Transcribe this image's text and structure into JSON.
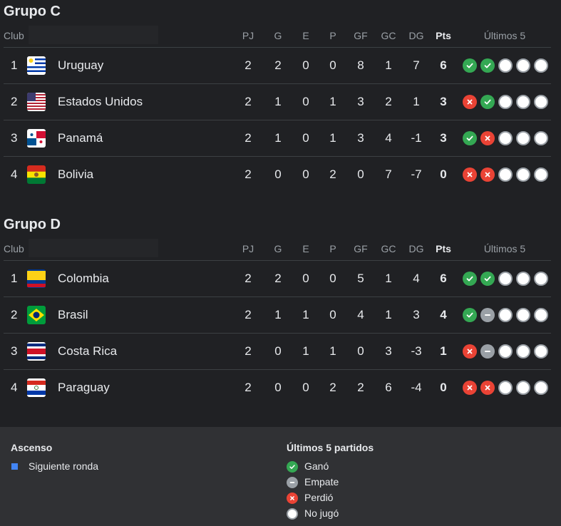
{
  "columns": {
    "club": "Club",
    "pj": "PJ",
    "g": "G",
    "e": "E",
    "p": "P",
    "gf": "GF",
    "gc": "GC",
    "dg": "DG",
    "pts": "Pts",
    "last5": "Últimos 5"
  },
  "groups": [
    {
      "title": "Grupo C",
      "teams": [
        {
          "pos": "1",
          "name": "Uruguay",
          "flag": "uruguay-flag",
          "pj": "2",
          "g": "2",
          "e": "0",
          "p": "0",
          "gf": "8",
          "gc": "1",
          "dg": "7",
          "pts": "6",
          "form": [
            "W",
            "W",
            "N",
            "N",
            "N"
          ]
        },
        {
          "pos": "2",
          "name": "Estados Unidos",
          "flag": "usa-flag",
          "pj": "2",
          "g": "1",
          "e": "0",
          "p": "1",
          "gf": "3",
          "gc": "2",
          "dg": "1",
          "pts": "3",
          "form": [
            "L",
            "W",
            "N",
            "N",
            "N"
          ]
        },
        {
          "pos": "3",
          "name": "Panamá",
          "flag": "panama-flag",
          "pj": "2",
          "g": "1",
          "e": "0",
          "p": "1",
          "gf": "3",
          "gc": "4",
          "dg": "-1",
          "pts": "3",
          "form": [
            "W",
            "L",
            "N",
            "N",
            "N"
          ]
        },
        {
          "pos": "4",
          "name": "Bolivia",
          "flag": "bolivia-flag",
          "pj": "2",
          "g": "0",
          "e": "0",
          "p": "2",
          "gf": "0",
          "gc": "7",
          "dg": "-7",
          "pts": "0",
          "form": [
            "L",
            "L",
            "N",
            "N",
            "N"
          ]
        }
      ]
    },
    {
      "title": "Grupo D",
      "teams": [
        {
          "pos": "1",
          "name": "Colombia",
          "flag": "colombia-flag",
          "pj": "2",
          "g": "2",
          "e": "0",
          "p": "0",
          "gf": "5",
          "gc": "1",
          "dg": "4",
          "pts": "6",
          "form": [
            "W",
            "W",
            "N",
            "N",
            "N"
          ]
        },
        {
          "pos": "2",
          "name": "Brasil",
          "flag": "brazil-flag",
          "pj": "2",
          "g": "1",
          "e": "1",
          "p": "0",
          "gf": "4",
          "gc": "1",
          "dg": "3",
          "pts": "4",
          "form": [
            "W",
            "D",
            "N",
            "N",
            "N"
          ]
        },
        {
          "pos": "3",
          "name": "Costa Rica",
          "flag": "costa-rica-flag",
          "pj": "2",
          "g": "0",
          "e": "1",
          "p": "1",
          "gf": "0",
          "gc": "3",
          "dg": "-3",
          "pts": "1",
          "form": [
            "L",
            "D",
            "N",
            "N",
            "N"
          ]
        },
        {
          "pos": "4",
          "name": "Paraguay",
          "flag": "paraguay-flag",
          "pj": "2",
          "g": "0",
          "e": "0",
          "p": "2",
          "gf": "2",
          "gc": "6",
          "dg": "-4",
          "pts": "0",
          "form": [
            "L",
            "L",
            "N",
            "N",
            "N"
          ]
        }
      ]
    }
  ],
  "legend": {
    "ascenso_title": "Ascenso",
    "ascenso_item": "Siguiente ronda",
    "form_title": "Últimos 5 partidos",
    "won": "Ganó",
    "draw": "Empate",
    "lost": "Perdió",
    "not_played": "No jugó"
  },
  "colors": {
    "won": "#34a853",
    "lost": "#ea4335",
    "draw": "#9aa0a6",
    "not_played": "#ffffff",
    "qualify": "#4285f4"
  }
}
